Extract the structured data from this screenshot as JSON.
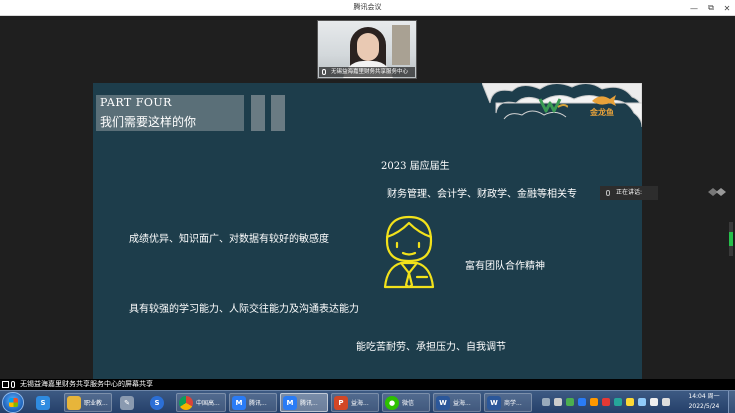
{
  "window": {
    "title": "腾讯会议",
    "controls": {
      "minimize": "—",
      "restore": "⧉",
      "close": "✕"
    }
  },
  "participant": {
    "name": "无锡益海嘉里财务共享服务中心"
  },
  "slide": {
    "part_en": "PART FOUR",
    "part_zh": "我们需要这样的你",
    "logo_tag": "金龙鱼",
    "lines": {
      "graduates": "2023 届应届生",
      "majors": "财务管理、会计学、财政学、金融等相关专",
      "grades": "成绩优异、知识面广、对数据有较好的敏感度",
      "teamwork": "富有团队合作精神",
      "skills": "具有较强的学习能力、人际交往能力及沟通表达能力",
      "endurance": "能吃苦耐劳、承担压力、自我调节"
    },
    "colors": {
      "background": "#1d3d4b",
      "mascot": "#f2e21b",
      "cloud": "#ececec"
    }
  },
  "speaking_indicator": "正在讲话:",
  "share_banner": "无锡益海嘉里财务共享服务中心的屏幕共享",
  "taskbar": {
    "apps": [
      {
        "label": "",
        "icon": "qq-pinyin-icon"
      },
      {
        "label": "职业教...",
        "icon": "folder-icon"
      },
      {
        "label": "",
        "icon": "tool-icon"
      },
      {
        "label": "",
        "icon": "sogou-icon"
      },
      {
        "label": "中国高...",
        "icon": "chrome-icon"
      },
      {
        "label": "腾讯...",
        "icon": "tencent-meeting-icon"
      },
      {
        "label": "腾讯...",
        "icon": "tencent-meeting-icon"
      },
      {
        "label": "益海...",
        "icon": "powerpoint-icon"
      },
      {
        "label": "微信",
        "icon": "wechat-icon"
      },
      {
        "label": "益海...",
        "icon": "word-icon"
      },
      {
        "label": "商学...",
        "icon": "word-icon"
      }
    ],
    "clock": {
      "time": "14:04 周一",
      "date": "2022/5/24"
    }
  }
}
